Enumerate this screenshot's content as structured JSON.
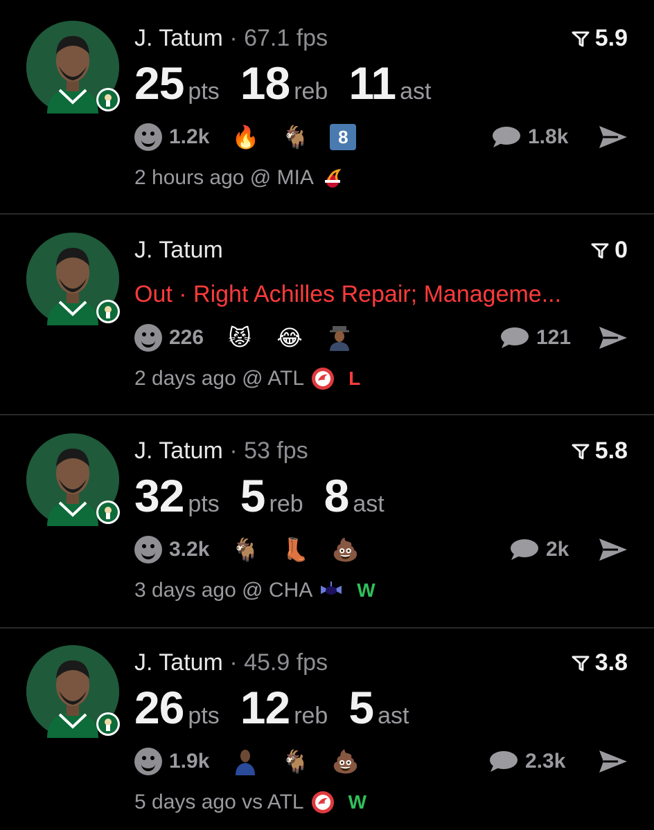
{
  "cards": [
    {
      "player": "J. Tatum",
      "fps": "67.1 fps",
      "rank": "5.9",
      "stats": [
        {
          "num": "25",
          "unit": "pts"
        },
        {
          "num": "18",
          "unit": "reb"
        },
        {
          "num": "11",
          "unit": "ast"
        }
      ],
      "reactions_count": "1.2k",
      "reactions": [
        "fire-emoji",
        "goat-emoji",
        "number-8-badge"
      ],
      "badge_text": "8",
      "comments": "1.8k",
      "time": "2 hours ago",
      "venue": "@ MIA",
      "opponent_logo": "heat-logo",
      "result": ""
    },
    {
      "player": "J. Tatum",
      "rank": "0",
      "injury": "Out · Right Achilles Repair; Manageme...",
      "reactions_count": "226",
      "reactions": [
        "pouting-cat-emoji",
        "crying-laughing-emoji",
        "person-avatar-emoji"
      ],
      "comments": "121",
      "time": "2 days ago",
      "venue": "@ ATL",
      "opponent_logo": "hawks-logo",
      "result": "L"
    },
    {
      "player": "J. Tatum",
      "fps": "53 fps",
      "rank": "5.8",
      "stats": [
        {
          "num": "32",
          "unit": "pts"
        },
        {
          "num": "5",
          "unit": "reb"
        },
        {
          "num": "8",
          "unit": "ast"
        }
      ],
      "reactions_count": "3.2k",
      "reactions": [
        "goat-emoji",
        "boot-emoji",
        "poop-emoji"
      ],
      "comments": "2k",
      "time": "3 days ago",
      "venue": "@ CHA",
      "opponent_logo": "hornets-logo",
      "result": "W"
    },
    {
      "player": "J. Tatum",
      "fps": "45.9 fps",
      "rank": "3.8",
      "stats": [
        {
          "num": "26",
          "unit": "pts"
        },
        {
          "num": "12",
          "unit": "reb"
        },
        {
          "num": "5",
          "unit": "ast"
        }
      ],
      "reactions_count": "1.9k",
      "reactions": [
        "player-avatar-emoji",
        "goat-emoji",
        "poop-emoji"
      ],
      "comments": "2.3k",
      "time": "5 days ago",
      "venue": "vs ATL",
      "opponent_logo": "hawks-logo",
      "result": "W"
    }
  ],
  "colors": {
    "background": "#000000",
    "injury_red": "#ff3b3b",
    "win_green": "#2fbf5b",
    "muted_gray": "#9a9a9f",
    "celtics_green": "#1f5a3a"
  }
}
